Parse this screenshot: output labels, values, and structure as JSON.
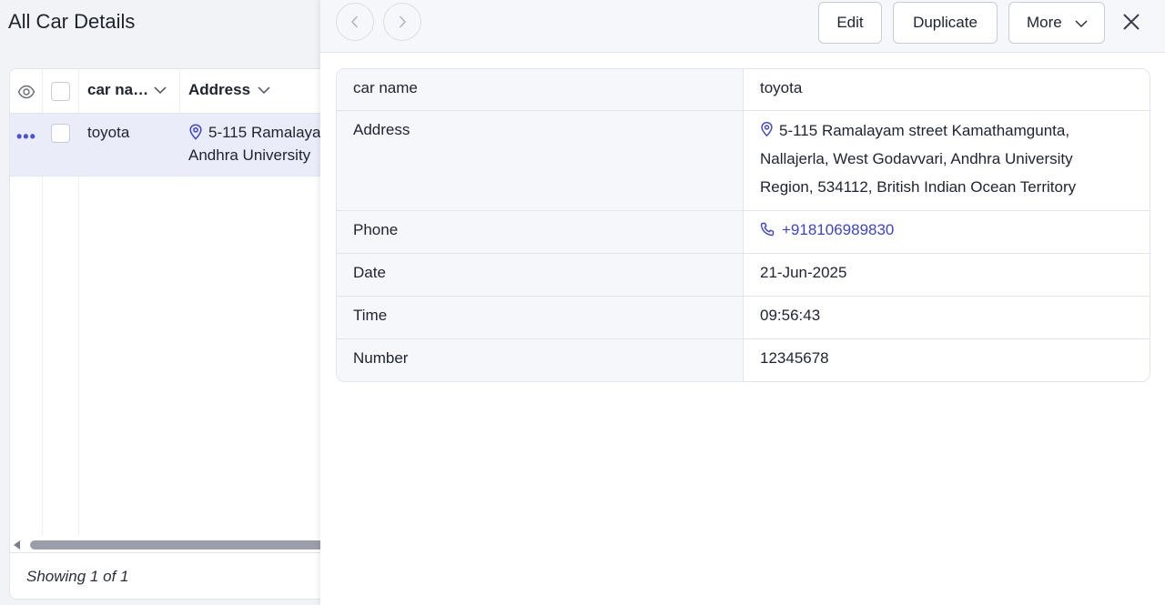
{
  "list": {
    "title": "All Car Details",
    "columns": [
      {
        "label": "car na…"
      },
      {
        "label": "Address"
      }
    ],
    "rows": [
      {
        "car_name": "toyota",
        "address_line1": "5-115 Ramalaya",
        "address_line2": "Andhra University"
      }
    ],
    "footer": "Showing 1 of 1"
  },
  "panel": {
    "buttons": {
      "edit": "Edit",
      "duplicate": "Duplicate",
      "more": "More"
    },
    "fields": {
      "car_name": {
        "label": "car name",
        "value": "toyota"
      },
      "address": {
        "label": "Address",
        "lines": [
          "5-115 Ramalayam street Kamathamgunta,",
          "Nallajerla, West Godavvari, Andhra University",
          "Region, 534112, British Indian Ocean Territory"
        ]
      },
      "phone": {
        "label": "Phone",
        "value": "+918106989830"
      },
      "date": {
        "label": "Date",
        "value": "21-Jun-2025"
      },
      "time": {
        "label": "Time",
        "value": "09:56:43"
      },
      "number": {
        "label": "Number",
        "value": "12345678"
      }
    }
  },
  "icons": [
    "eye-icon",
    "chevron-down-icon",
    "more-dots-icon",
    "location-pin-icon",
    "phone-icon",
    "chevron-left-icon",
    "chevron-right-icon",
    "close-icon"
  ],
  "colors": {
    "accent": "#3d44c7",
    "selected_row": "#eaecfa",
    "label_cell": "#f6f7fb"
  }
}
